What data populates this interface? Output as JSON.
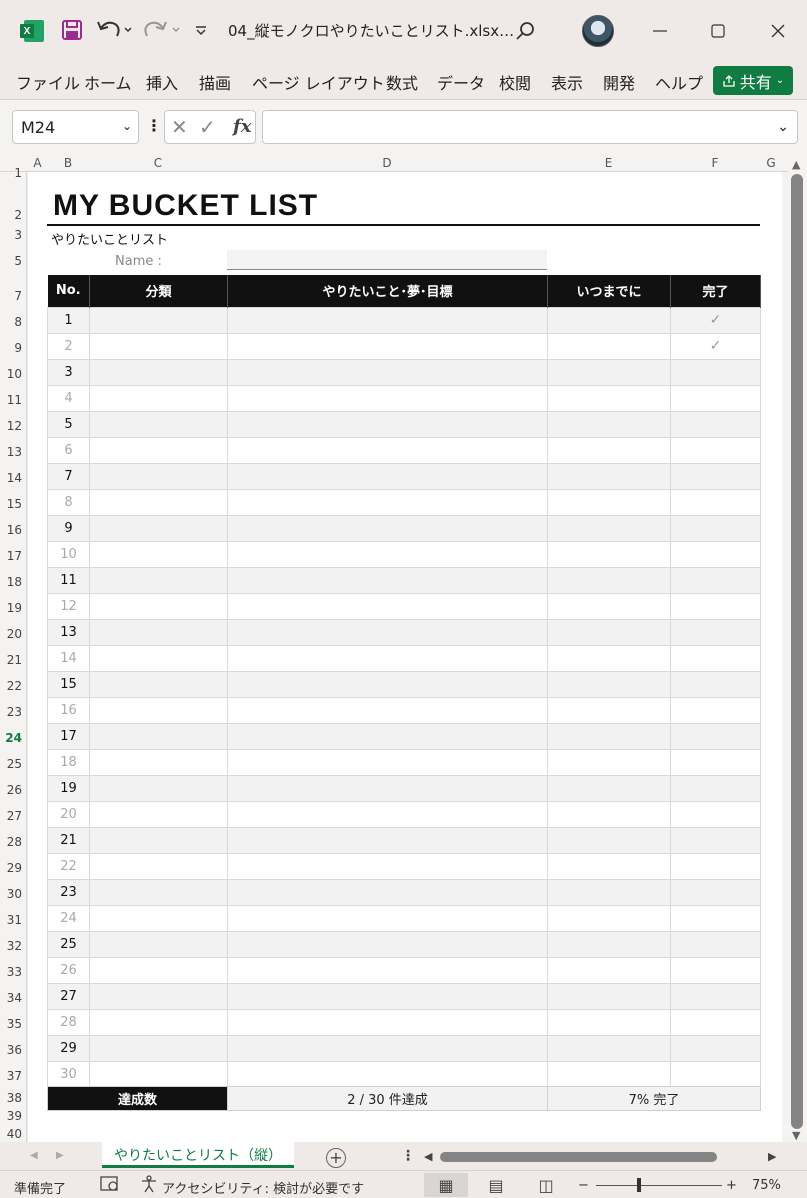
{
  "titlebar": {
    "doc_title": "04_縦モノクロやりたいことリスト.xlsx…",
    "excel_badge": "X"
  },
  "ribbon": {
    "tabs": [
      "ファイル",
      "ホーム",
      "挿入",
      "描画",
      "ページ レイアウト",
      "数式",
      "データ",
      "校閲",
      "表示",
      "開発",
      "ヘルプ"
    ],
    "share_label": "共有"
  },
  "formula_bar": {
    "name_box": "M24",
    "fx_label": "fx",
    "formula": ""
  },
  "columns": [
    "A",
    "B",
    "C",
    "D",
    "E",
    "F",
    "G"
  ],
  "rows": [
    "1",
    "2",
    "3",
    "5",
    "7",
    "8",
    "9",
    "10",
    "11",
    "12",
    "13",
    "14",
    "15",
    "16",
    "17",
    "18",
    "19",
    "20",
    "21",
    "22",
    "23",
    "24",
    "25",
    "26",
    "27",
    "28",
    "29",
    "30",
    "31",
    "32",
    "33",
    "34",
    "35",
    "36",
    "37",
    "38",
    "39",
    "40"
  ],
  "active_row": "24",
  "worksheet": {
    "title": "MY BUCKET LIST",
    "subtitle": "やりたいことリスト",
    "name_label": "Name :",
    "name_value": "",
    "headers": {
      "no": "No.",
      "category": "分類",
      "item": "やりたいこと･夢･目標",
      "deadline": "いつまでに",
      "done": "完了"
    },
    "items": [
      {
        "no": "1",
        "category": "",
        "item": "",
        "deadline": "",
        "done": "✓"
      },
      {
        "no": "2",
        "category": "",
        "item": "",
        "deadline": "",
        "done": "✓"
      },
      {
        "no": "3",
        "category": "",
        "item": "",
        "deadline": "",
        "done": ""
      },
      {
        "no": "4",
        "category": "",
        "item": "",
        "deadline": "",
        "done": ""
      },
      {
        "no": "5",
        "category": "",
        "item": "",
        "deadline": "",
        "done": ""
      },
      {
        "no": "6",
        "category": "",
        "item": "",
        "deadline": "",
        "done": ""
      },
      {
        "no": "7",
        "category": "",
        "item": "",
        "deadline": "",
        "done": ""
      },
      {
        "no": "8",
        "category": "",
        "item": "",
        "deadline": "",
        "done": ""
      },
      {
        "no": "9",
        "category": "",
        "item": "",
        "deadline": "",
        "done": ""
      },
      {
        "no": "10",
        "category": "",
        "item": "",
        "deadline": "",
        "done": ""
      },
      {
        "no": "11",
        "category": "",
        "item": "",
        "deadline": "",
        "done": ""
      },
      {
        "no": "12",
        "category": "",
        "item": "",
        "deadline": "",
        "done": ""
      },
      {
        "no": "13",
        "category": "",
        "item": "",
        "deadline": "",
        "done": ""
      },
      {
        "no": "14",
        "category": "",
        "item": "",
        "deadline": "",
        "done": ""
      },
      {
        "no": "15",
        "category": "",
        "item": "",
        "deadline": "",
        "done": ""
      },
      {
        "no": "16",
        "category": "",
        "item": "",
        "deadline": "",
        "done": ""
      },
      {
        "no": "17",
        "category": "",
        "item": "",
        "deadline": "",
        "done": ""
      },
      {
        "no": "18",
        "category": "",
        "item": "",
        "deadline": "",
        "done": ""
      },
      {
        "no": "19",
        "category": "",
        "item": "",
        "deadline": "",
        "done": ""
      },
      {
        "no": "20",
        "category": "",
        "item": "",
        "deadline": "",
        "done": ""
      },
      {
        "no": "21",
        "category": "",
        "item": "",
        "deadline": "",
        "done": ""
      },
      {
        "no": "22",
        "category": "",
        "item": "",
        "deadline": "",
        "done": ""
      },
      {
        "no": "23",
        "category": "",
        "item": "",
        "deadline": "",
        "done": ""
      },
      {
        "no": "24",
        "category": "",
        "item": "",
        "deadline": "",
        "done": ""
      },
      {
        "no": "25",
        "category": "",
        "item": "",
        "deadline": "",
        "done": ""
      },
      {
        "no": "26",
        "category": "",
        "item": "",
        "deadline": "",
        "done": ""
      },
      {
        "no": "27",
        "category": "",
        "item": "",
        "deadline": "",
        "done": ""
      },
      {
        "no": "28",
        "category": "",
        "item": "",
        "deadline": "",
        "done": ""
      },
      {
        "no": "29",
        "category": "",
        "item": "",
        "deadline": "",
        "done": ""
      },
      {
        "no": "30",
        "category": "",
        "item": "",
        "deadline": "",
        "done": ""
      }
    ],
    "summary": {
      "label": "達成数",
      "count_text": "2 / 30 件達成",
      "percent_text": "7% 完了"
    }
  },
  "sheet_tabs": {
    "active": "やりたいことリスト（縦）",
    "add_label": "+"
  },
  "statusbar": {
    "ready": "準備完了",
    "accessibility": "アクセシビリティ: 検討が必要です",
    "zoom_minus": "−",
    "zoom_plus": "+",
    "zoom": "75%"
  },
  "colors": {
    "accent": "#107c41",
    "header_bg": "#111111",
    "stripe": "#f2f2f2"
  }
}
